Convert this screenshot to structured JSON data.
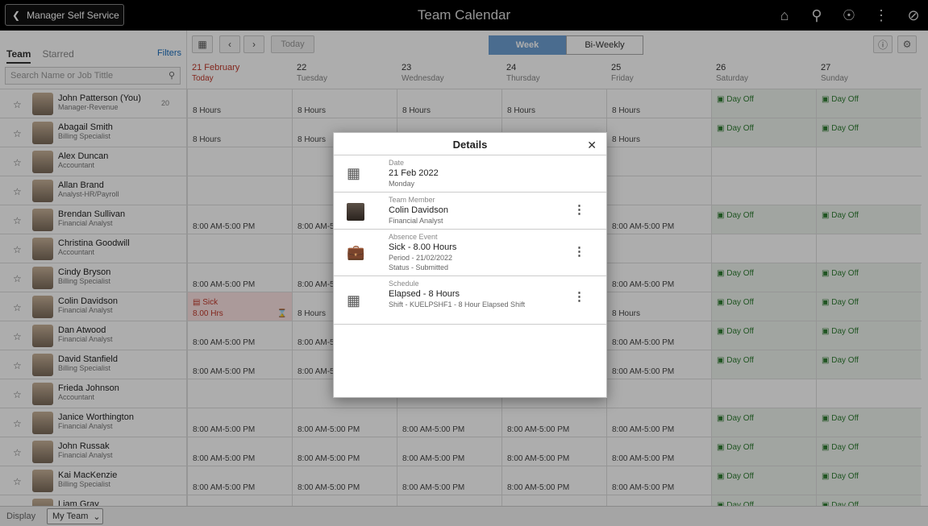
{
  "topbar": {
    "back_label": "Manager Self Service",
    "title": "Team Calendar"
  },
  "left": {
    "tab_team": "Team",
    "tab_starred": "Starred",
    "filters": "Filters",
    "search_placeholder": "Search Name or Job Tittle"
  },
  "toolbar": {
    "today": "Today",
    "week": "Week",
    "biweekly": "Bi-Weekly"
  },
  "days": [
    {
      "num": "21 February",
      "week": "Today",
      "today": true
    },
    {
      "num": "22",
      "week": "Tuesday"
    },
    {
      "num": "23",
      "week": "Wednesday"
    },
    {
      "num": "24",
      "week": "Thursday"
    },
    {
      "num": "25",
      "week": "Friday"
    },
    {
      "num": "26",
      "week": "Saturday"
    },
    {
      "num": "27",
      "week": "Sunday"
    }
  ],
  "employees": [
    {
      "name": "John Patterson (You)",
      "title": "Manager-Revenue",
      "count": "20",
      "cells": [
        "8 Hours",
        "8 Hours",
        "8 Hours",
        "8 Hours",
        "8 Hours",
        "off",
        "off"
      ]
    },
    {
      "name": "Abagail Smith",
      "title": "Billing Specialist",
      "cells": [
        "8 Hours",
        "8 Hours",
        "",
        "",
        "8 Hours",
        "off",
        "off"
      ]
    },
    {
      "name": "Alex Duncan",
      "title": "Accountant",
      "cells": [
        "",
        "",
        "",
        "",
        "",
        "",
        ""
      ]
    },
    {
      "name": "Allan Brand",
      "title": "Analyst-HR/Payroll",
      "cells": [
        "",
        "",
        "",
        "",
        "",
        "",
        ""
      ]
    },
    {
      "name": "Brendan Sullivan",
      "title": "Financial Analyst",
      "cells": [
        "8:00 AM-5:00 PM",
        "8:00 AM-5:00 PM",
        "",
        "",
        "8:00 AM-5:00 PM",
        "off",
        "off"
      ]
    },
    {
      "name": "Christina Goodwill",
      "title": "Accountant",
      "cells": [
        "",
        "",
        "",
        "",
        "",
        "",
        ""
      ]
    },
    {
      "name": "Cindy Bryson",
      "title": "Billing Specialist",
      "cells": [
        "8:00 AM-5:00 PM",
        "8:00 AM-5:00 PM",
        "",
        "",
        "8:00 AM-5:00 PM",
        "off",
        "off"
      ]
    },
    {
      "name": "Colin Davidson",
      "title": "Financial Analyst",
      "cells": [
        "sick",
        "8 Hours",
        "",
        "",
        "8 Hours",
        "off",
        "off"
      ]
    },
    {
      "name": "Dan Atwood",
      "title": "Financial Analyst",
      "cells": [
        "8:00 AM-5:00 PM",
        "8:00 AM-5:00 PM",
        "",
        "",
        "8:00 AM-5:00 PM",
        "off",
        "off"
      ]
    },
    {
      "name": "David Stanfield",
      "title": "Billing Specialist",
      "cells": [
        "8:00 AM-5:00 PM",
        "8:00 AM-5:00 PM",
        "",
        "",
        "8:00 AM-5:00 PM",
        "off",
        "off"
      ]
    },
    {
      "name": "Frieda Johnson",
      "title": "Accountant",
      "cells": [
        "",
        "",
        "",
        "",
        "",
        "",
        ""
      ]
    },
    {
      "name": "Janice Worthington",
      "title": "Financial Analyst",
      "cells": [
        "8:00 AM-5:00 PM",
        "8:00 AM-5:00 PM",
        "8:00 AM-5:00 PM",
        "8:00 AM-5:00 PM",
        "8:00 AM-5:00 PM",
        "off",
        "off"
      ]
    },
    {
      "name": "John Russak",
      "title": "Financial Analyst",
      "cells": [
        "8:00 AM-5:00 PM",
        "8:00 AM-5:00 PM",
        "8:00 AM-5:00 PM",
        "8:00 AM-5:00 PM",
        "8:00 AM-5:00 PM",
        "off",
        "off"
      ]
    },
    {
      "name": "Kai MacKenzie",
      "title": "Billing Specialist",
      "cells": [
        "8:00 AM-5:00 PM",
        "8:00 AM-5:00 PM",
        "8:00 AM-5:00 PM",
        "8:00 AM-5:00 PM",
        "8:00 AM-5:00 PM",
        "off",
        "off"
      ]
    },
    {
      "name": "Liam Gray",
      "title": "",
      "cells": [
        "",
        "",
        "",
        "",
        "",
        "off",
        "off"
      ]
    }
  ],
  "labels": {
    "day_off": "Day Off",
    "sick": "Sick",
    "sick_hours": "8.00 Hrs"
  },
  "bottom": {
    "display": "Display",
    "team_select": "My Team"
  },
  "details": {
    "title": "Details",
    "date_label": "Date",
    "date_value": "21 Feb 2022",
    "date_sub": "Monday",
    "member_label": "Team Member",
    "member_value": "Colin Davidson",
    "member_sub": "Financial Analyst",
    "absence_label": "Absence Event",
    "absence_value": "Sick - 8.00 Hours",
    "absence_period": "Period - 21/02/2022",
    "absence_status": "Status - Submitted",
    "schedule_label": "Schedule",
    "schedule_value": "Elapsed - 8 Hours",
    "schedule_sub": "Shift - KUELPSHF1 - 8 Hour Elapsed Shift"
  }
}
